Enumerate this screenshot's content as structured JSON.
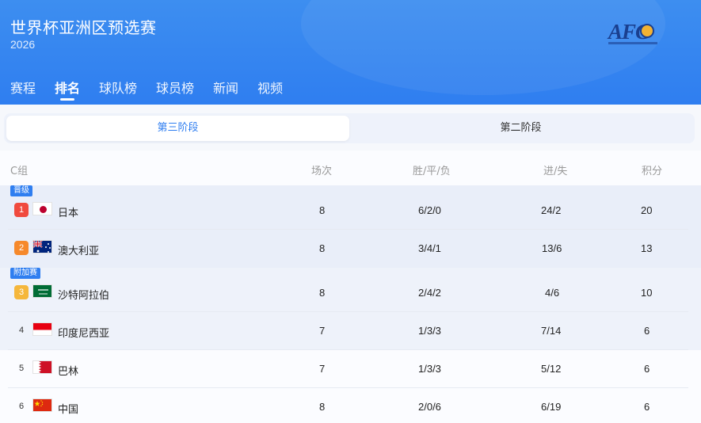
{
  "header": {
    "title": "世界杯亚洲区预选赛",
    "year": "2026",
    "logo_text": "AFC"
  },
  "tabs": [
    {
      "label": "赛程",
      "active": false
    },
    {
      "label": "排名",
      "active": true
    },
    {
      "label": "球队榜",
      "active": false
    },
    {
      "label": "球员榜",
      "active": false
    },
    {
      "label": "新闻",
      "active": false
    },
    {
      "label": "视频",
      "active": false
    }
  ],
  "stages": {
    "active": "第三阶段",
    "inactive": "第二阶段"
  },
  "table": {
    "group": "C组",
    "columns": {
      "played": "场次",
      "wdl": "胜/平/负",
      "goals": "进/失",
      "points": "积分"
    },
    "badges": {
      "qualified": "晋级",
      "playoff": "附加赛"
    },
    "rows": [
      {
        "rank": "1",
        "team": "日本",
        "flag": "japan-flag-icon",
        "played": "8",
        "wdl": "6/2/0",
        "goals": "24/2",
        "points": "20"
      },
      {
        "rank": "2",
        "team": "澳大利亚",
        "flag": "australia-flag-icon",
        "played": "8",
        "wdl": "3/4/1",
        "goals": "13/6",
        "points": "13"
      },
      {
        "rank": "3",
        "team": "沙特阿拉伯",
        "flag": "saudi-arabia-flag-icon",
        "played": "8",
        "wdl": "2/4/2",
        "goals": "4/6",
        "points": "10"
      },
      {
        "rank": "4",
        "team": "印度尼西亚",
        "flag": "indonesia-flag-icon",
        "played": "7",
        "wdl": "1/3/3",
        "goals": "7/14",
        "points": "6"
      },
      {
        "rank": "5",
        "team": "巴林",
        "flag": "bahrain-flag-icon",
        "played": "7",
        "wdl": "1/3/3",
        "goals": "5/12",
        "points": "6"
      },
      {
        "rank": "6",
        "team": "中国",
        "flag": "china-flag-icon",
        "played": "8",
        "wdl": "2/0/6",
        "goals": "6/19",
        "points": "6"
      }
    ]
  },
  "colors": {
    "header_blue": "#2f7ef0",
    "rank_1": "#f04a3e",
    "rank_2": "#f6892c",
    "rank_3": "#f5b73b",
    "highlight_bg": "#e9eef9"
  }
}
